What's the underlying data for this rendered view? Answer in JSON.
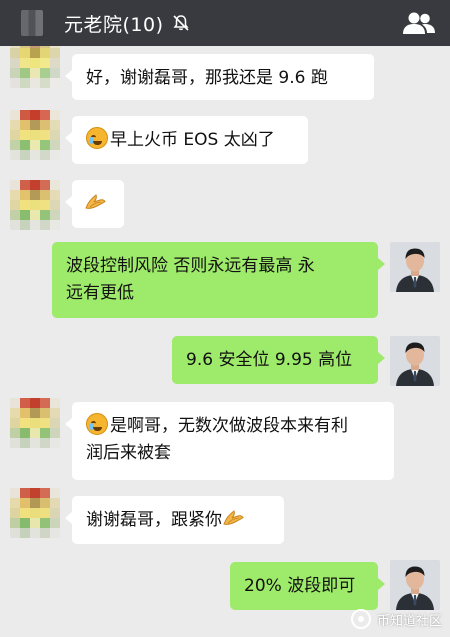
{
  "header": {
    "title": "元老院(10)",
    "mute_icon": "bell-off-icon",
    "members_icon": "group-members-icon",
    "background": "#393a3f"
  },
  "messages": [
    {
      "side": "left",
      "text": "好，谢谢磊哥，那我还是 9.6 跑"
    },
    {
      "side": "left",
      "emoji": "tears-of-joy-emoji",
      "text": "早上火币 EOS 太凶了"
    },
    {
      "side": "left",
      "emoji": "folded-hands-emoji",
      "text": ""
    },
    {
      "side": "right",
      "text_line1": "波段控制风险 否则永远有最高 永",
      "text_line2": "远有更低"
    },
    {
      "side": "right",
      "text": "9.6 安全位 9.95 高位"
    },
    {
      "side": "left",
      "emoji": "tears-of-joy-emoji",
      "text_line1": "是啊哥，无数次做波段本来有利",
      "text_line2": "润后来被套"
    },
    {
      "side": "left",
      "text": "谢谢磊哥，跟紧你",
      "emoji": "folded-hands-emoji"
    },
    {
      "side": "right",
      "text": "20% 波段即可"
    }
  ],
  "watermark": {
    "text": "币知道社区",
    "icon": "wechat-channel-icon"
  },
  "colors": {
    "chat_bg": "#ebebeb",
    "right_bubble": "#9eea6a",
    "left_bubble": "#ffffff"
  }
}
